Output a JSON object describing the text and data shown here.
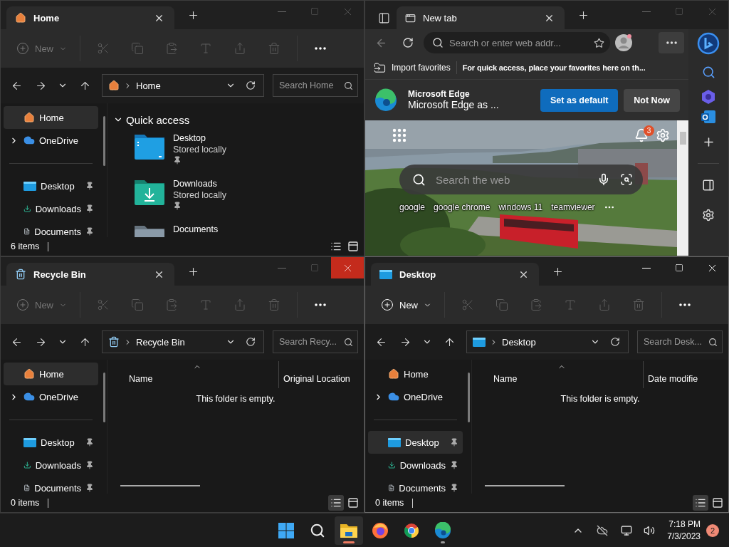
{
  "windows": [
    {
      "kind": "explorer",
      "active": false,
      "close_hovered": false,
      "tab": {
        "kind": "home",
        "title": "Home"
      },
      "new_label": "New",
      "new_disabled": true,
      "address": {
        "kind": "home",
        "location": "Home"
      },
      "search_placeholder": "Search Home",
      "nav": [
        {
          "kind": "plain",
          "label": "Home",
          "selected": true
        },
        {
          "kind": "tree",
          "label": "OneDrive",
          "expanded": false,
          "selected": false
        }
      ],
      "pinned": [
        {
          "kind": "desktop",
          "label": "Desktop",
          "selected": false
        },
        {
          "kind": "downloads",
          "label": "Downloads",
          "selected": false
        },
        {
          "kind": "documents",
          "label": "Documents",
          "selected": false
        }
      ],
      "content": {
        "kind": "quick_access",
        "heading": "Quick access",
        "expanded": true,
        "items": [
          {
            "kind": "desktop",
            "name": "Desktop",
            "detail": "Stored locally",
            "pinned": true
          },
          {
            "kind": "downloads",
            "name": "Downloads",
            "detail": "Stored locally",
            "pinned": true
          },
          {
            "kind": "documents",
            "name": "Documents"
          }
        ]
      },
      "status": "6 items",
      "views": [
        {
          "kind": "details",
          "selected": false
        },
        {
          "kind": "preview",
          "selected": false
        }
      ]
    },
    {
      "kind": "browser",
      "tab": {
        "title": "New tab"
      },
      "address_placeholder": "Search or enter web addr...",
      "favorites_bar": {
        "import": "Import favorites",
        "hint": "For quick access, place your favorites here on th..."
      },
      "banner": {
        "title": "Microsoft Edge",
        "text": "Microsoft Edge as ...",
        "buttons": [
          {
            "label": "Set as default",
            "primary": true
          },
          {
            "label": "Not Now",
            "primary": false
          }
        ]
      },
      "new_tab_page": {
        "notification_count": "3",
        "search_placeholder": "Search the web",
        "suggestions": [
          "google",
          "google chrome",
          "windows 11",
          "teamviewer"
        ]
      }
    },
    {
      "kind": "explorer",
      "active": false,
      "close_hovered": true,
      "tab": {
        "kind": "recycle",
        "title": "Recycle Bin"
      },
      "new_label": "New",
      "new_disabled": true,
      "address": {
        "kind": "recycle",
        "location": "Recycle Bin"
      },
      "search_placeholder": "Search Recy...",
      "nav": [
        {
          "kind": "plain",
          "label": "Home",
          "selected": true
        },
        {
          "kind": "tree",
          "label": "OneDrive",
          "expanded": false,
          "selected": false
        }
      ],
      "pinned": [
        {
          "kind": "desktop",
          "label": "Desktop",
          "selected": false
        },
        {
          "kind": "downloads",
          "label": "Downloads",
          "selected": false
        },
        {
          "kind": "documents",
          "label": "Documents",
          "selected": false
        }
      ],
      "content": {
        "kind": "details",
        "columns": [
          {
            "label": "Name",
            "sorted": true
          },
          {
            "label": "Original Location",
            "sorted": false
          }
        ],
        "empty_message": "This folder is empty."
      },
      "status": "0 items",
      "views": [
        {
          "kind": "details",
          "selected": true
        },
        {
          "kind": "preview",
          "selected": false
        }
      ]
    },
    {
      "kind": "explorer",
      "active": true,
      "close_hovered": false,
      "tab": {
        "kind": "desktop",
        "title": "Desktop"
      },
      "new_label": "New",
      "new_disabled": false,
      "address": {
        "kind": "desktop",
        "location": "Desktop"
      },
      "search_placeholder": "Search Desk...",
      "nav": [
        {
          "kind": "plain",
          "label": "Home",
          "selected": false
        },
        {
          "kind": "tree",
          "label": "OneDrive",
          "expanded": false,
          "selected": false
        }
      ],
      "pinned": [
        {
          "kind": "desktop",
          "label": "Desktop",
          "selected": true
        },
        {
          "kind": "downloads",
          "label": "Downloads",
          "selected": false
        },
        {
          "kind": "documents",
          "label": "Documents",
          "selected": false
        }
      ],
      "content": {
        "kind": "details",
        "columns": [
          {
            "label": "Name",
            "sorted": true
          },
          {
            "label": "Date modifie",
            "sorted": false
          }
        ],
        "empty_message": "This folder is empty."
      },
      "status": "0 items",
      "views": [
        {
          "kind": "details",
          "selected": true
        },
        {
          "kind": "preview",
          "selected": false
        }
      ]
    }
  ],
  "taskbar": {
    "apps": [
      {
        "kind": "explorer",
        "active": true,
        "running": true
      },
      {
        "kind": "firefox",
        "active": false,
        "running": false
      },
      {
        "kind": "chrome",
        "active": false,
        "running": false
      },
      {
        "kind": "edge",
        "active": false,
        "running": true
      }
    ],
    "clock": {
      "time": "7:18 PM",
      "date": "7/3/2023"
    },
    "notification_count": "2"
  }
}
